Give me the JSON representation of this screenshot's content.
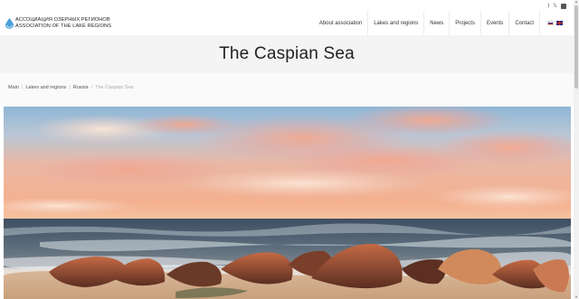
{
  "social": {
    "icons": [
      "tumblr-icon",
      "x-icon",
      "square-icon"
    ],
    "glyphs": [
      "t",
      "𝕏",
      "▪"
    ]
  },
  "logo": {
    "line1": "АССОЦИАЦИЯ ОЗЕРНЫХ РЕГИОНОВ",
    "line2": "ASSOCIATION OF THE LAKE REGIONS",
    "accent": "#4a9fd8"
  },
  "nav": {
    "items": [
      {
        "label": "About association"
      },
      {
        "label": "Lakes and regions"
      },
      {
        "label": "News"
      },
      {
        "label": "Projects"
      },
      {
        "label": "Events"
      },
      {
        "label": "Contact"
      }
    ],
    "languages": [
      "ru",
      "en"
    ]
  },
  "page": {
    "title": "The Caspian Sea"
  },
  "breadcrumb": {
    "items": [
      "Main",
      "Lakes and regions",
      "Russia"
    ],
    "current": "The Caspian Sea"
  },
  "hero": {
    "description_icon": "photo-seascape"
  }
}
